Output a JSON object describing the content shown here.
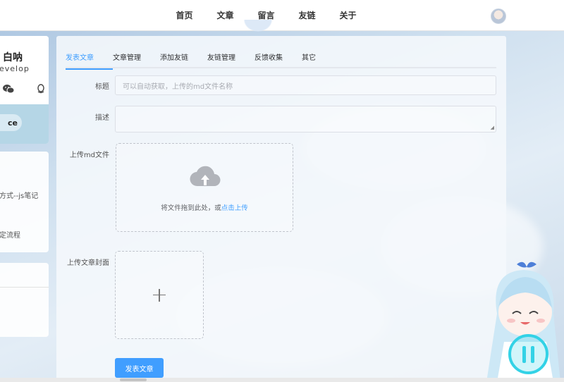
{
  "nav": {
    "items": [
      {
        "label": "首页"
      },
      {
        "label": "文章"
      },
      {
        "label": "留言"
      },
      {
        "label": "友链"
      },
      {
        "label": "关于"
      }
    ]
  },
  "sidebar": {
    "profile_name": "白呐",
    "profile_sub": "evelop",
    "pill_label": "ce",
    "recent": [
      {
        "title": "方式--js笔记"
      },
      {
        "title": "定流程"
      }
    ]
  },
  "tabs": [
    {
      "label": "发表文章",
      "active": true
    },
    {
      "label": "文章管理",
      "active": false
    },
    {
      "label": "添加友链",
      "active": false
    },
    {
      "label": "友链管理",
      "active": false
    },
    {
      "label": "反馈收集",
      "active": false
    },
    {
      "label": "其它",
      "active": false
    }
  ],
  "form": {
    "title_label": "标题",
    "title_placeholder": "可以自动获取，上传的md文件名称",
    "desc_label": "描述",
    "upload_md_label": "上传md文件",
    "upload_hint_prefix": "将文件拖到此处，或",
    "upload_hint_link": "点击上传",
    "cover_label": "上传文章封面",
    "submit_label": "发表文章"
  },
  "colors": {
    "accent": "#409eff",
    "music_button": "#33d2e6"
  },
  "icons": [
    "wechat-icon",
    "qq-icon",
    "cloud-upload-icon",
    "plus-icon",
    "pause-icon"
  ]
}
